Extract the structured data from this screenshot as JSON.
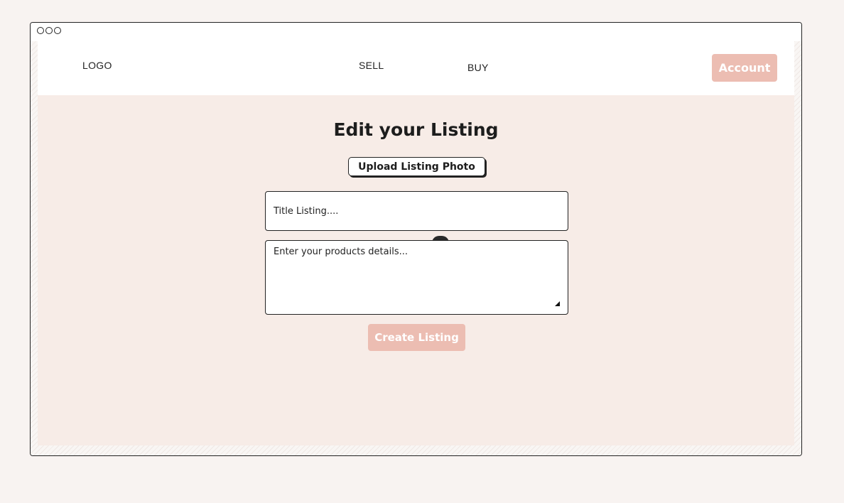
{
  "navbar": {
    "logo": "LOGO",
    "links": [
      "SELL",
      "BUY"
    ],
    "account_label": "Account"
  },
  "main": {
    "heading": "Edit your Listing",
    "upload_label": "Upload Listing Photo",
    "title_placeholder": "Title Listing....",
    "details_placeholder": "Enter your products details...",
    "create_label": "Create Listing"
  },
  "colors": {
    "accent": "#ecbdb2",
    "page_background": "#f7ece7",
    "outer_background": "#f8f3f1"
  }
}
